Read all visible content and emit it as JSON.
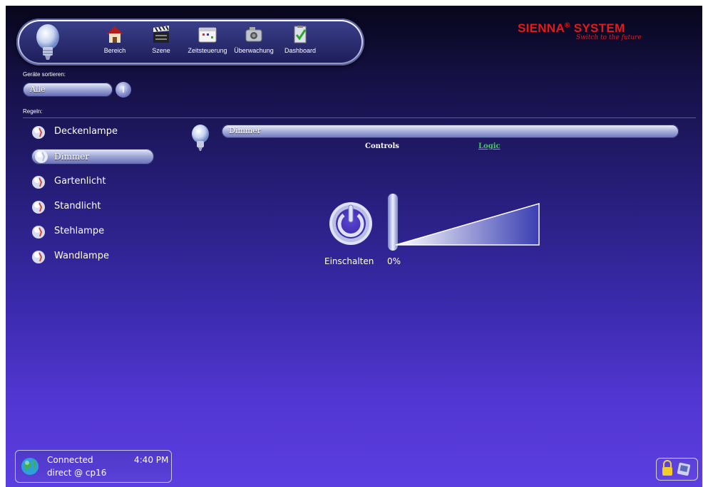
{
  "nav": {
    "items": [
      {
        "label": "Bereich",
        "icon": "house-icon"
      },
      {
        "label": "Szene",
        "icon": "clapperboard-icon"
      },
      {
        "label": "Zeitsteuerung",
        "icon": "calendar-icon"
      },
      {
        "label": "Überwachung",
        "icon": "camera-icon"
      },
      {
        "label": "Dashboard",
        "icon": "clipboard-check-icon"
      }
    ]
  },
  "brand": {
    "name": "SIENNA",
    "registered": "®",
    "suffix": " SYSTEM",
    "tagline": "Switch to the future",
    "color": "#e41a1a"
  },
  "sort": {
    "label": "Geräte sortieren:",
    "value": "Alle"
  },
  "section": {
    "label": "Regeln:"
  },
  "devices": [
    {
      "label": "Deckenlampe",
      "selected": false
    },
    {
      "label": "Dimmer",
      "selected": true
    },
    {
      "label": "Gartenlicht",
      "selected": false
    },
    {
      "label": "Standlicht",
      "selected": false
    },
    {
      "label": "Stehlampe",
      "selected": false
    },
    {
      "label": "Wandlampe",
      "selected": false
    }
  ],
  "detail": {
    "title": "Dimmer",
    "tabs": {
      "controls": "Controls",
      "logic": "Logic"
    },
    "power_label": "Einschalten",
    "level_label": "0%",
    "level": 0
  },
  "status": {
    "connection": "Connected",
    "time": "4:40 PM",
    "host": "direct @ cp16"
  },
  "colors": {
    "logic_link": "#3bd14a",
    "background_top": "#07061a",
    "background_bottom": "#5b3ee0"
  }
}
